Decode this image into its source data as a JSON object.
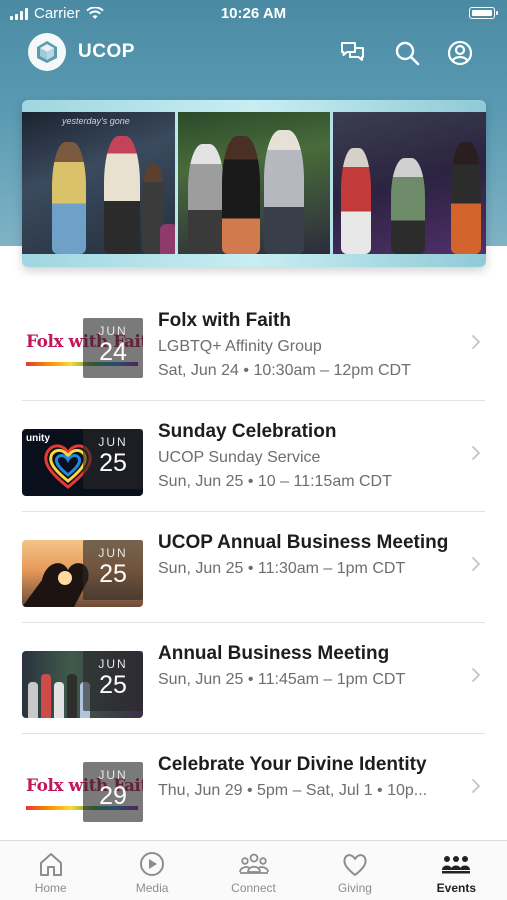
{
  "status_bar": {
    "carrier": "Carrier",
    "time": "10:26 AM"
  },
  "app": {
    "title": "UCOP"
  },
  "hero": {
    "caption": "yesterday's gone"
  },
  "events": [
    {
      "month": "JUN",
      "day": "24",
      "title": "Folx with Faith",
      "lines": [
        "LGBTQ+ Affinity Group",
        "Sat, Jun 24 • 10:30am – 12pm CDT"
      ],
      "thumb": "folx-with-faith-logo",
      "thumb_text": "Folx with Faith"
    },
    {
      "month": "JUN",
      "day": "25",
      "title": "Sunday Celebration",
      "lines": [
        "UCOP Sunday Service",
        "Sun, Jun 25 • 10 – 11:15am CDT"
      ],
      "thumb": "unity-heart-logo",
      "thumb_text": "unity"
    },
    {
      "month": "JUN",
      "day": "25",
      "title": "UCOP Annual Business Meeting",
      "lines": [
        "Sun, Jun 25 • 11:30am – 1pm CDT"
      ],
      "thumb": "heart-hands-sunset",
      "thumb_text": ""
    },
    {
      "month": "JUN",
      "day": "25",
      "title": "Annual Business Meeting",
      "lines": [
        "Sun, Jun 25 • 11:45am – 1pm CDT"
      ],
      "thumb": "event-photo-collage",
      "thumb_text": ""
    },
    {
      "month": "JUN",
      "day": "29",
      "title": "Celebrate Your Divine Identity",
      "lines": [
        "Thu, Jun 29 • 5pm – Sat, Jul 1 • 10p..."
      ],
      "thumb": "folx-with-faith-logo",
      "thumb_text": "Folx with Faith"
    }
  ],
  "tabs": [
    {
      "label": "Home",
      "icon": "home-icon",
      "active": false
    },
    {
      "label": "Media",
      "icon": "play-icon",
      "active": false
    },
    {
      "label": "Connect",
      "icon": "people-icon",
      "active": false
    },
    {
      "label": "Giving",
      "icon": "heart-icon",
      "active": false
    },
    {
      "label": "Events",
      "icon": "group-icon",
      "active": true
    }
  ],
  "colors": {
    "header": "#5a9ab2",
    "tab_active": "#222222",
    "tab_inactive": "#8d8d8d"
  }
}
